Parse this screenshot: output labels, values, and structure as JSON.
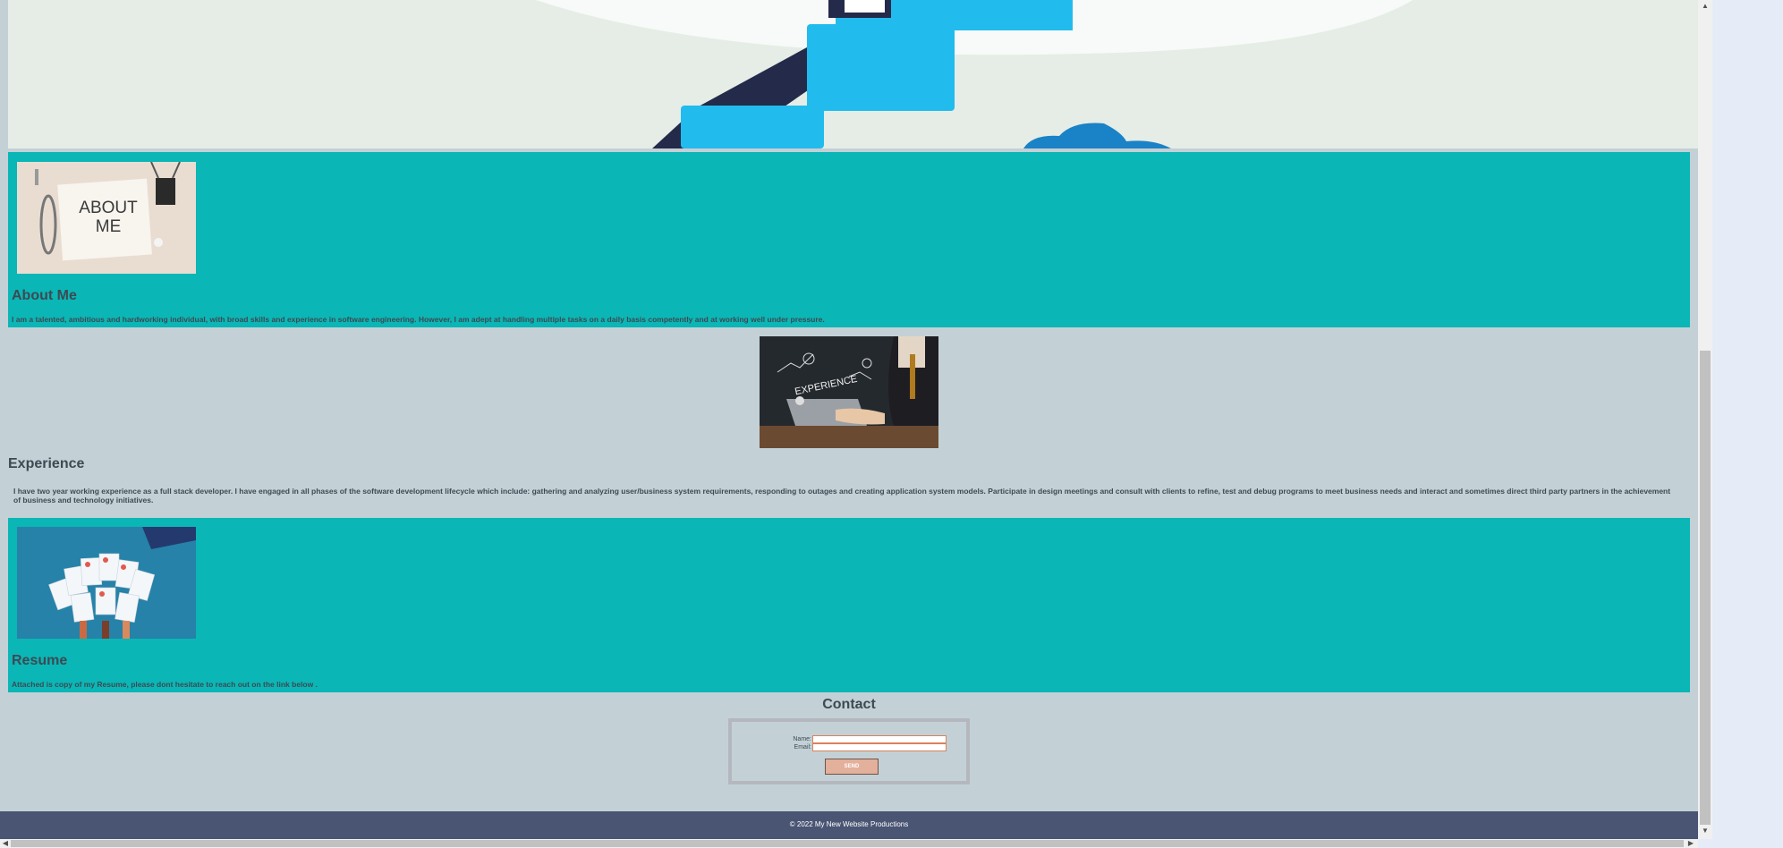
{
  "about": {
    "image_caption": "ABOUT ME",
    "title": "About Me",
    "text": "I am a talented, ambitious and hardworking individual, with broad skills and experience in software engineering. However, I am adept at handling multiple tasks on a daily basis competently and at working well under pressure."
  },
  "experience": {
    "image_caption": "EXPERIENCE",
    "title": "Experience",
    "text": "I have two year working experience as a full stack developer. I have engaged in all phases of the software development lifecycle which include: gathering and analyzing user/business system requirements, responding to outages and creating application system models. Participate in design meetings and consult with clients to refine, test and debug programs to meet business needs and interact and sometimes direct third party partners in the achievement of business and technology initiatives."
  },
  "resume": {
    "title": "Resume",
    "text": "Attached is copy of my Resume, please dont hesitate to reach out on the link below ."
  },
  "contact": {
    "title": "Contact",
    "name_label": "Name:",
    "email_label": "Email:",
    "name_value": "",
    "email_value": "",
    "send_label": "SEND"
  },
  "footer": {
    "text": "© 2022 My New Website Productions"
  },
  "colors": {
    "teal_section": "#0bb6b6",
    "page_background": "#c3d1d6",
    "footer_background": "#4a5573",
    "send_button": "#e3b09c",
    "hero_blue": "#22bbee"
  }
}
